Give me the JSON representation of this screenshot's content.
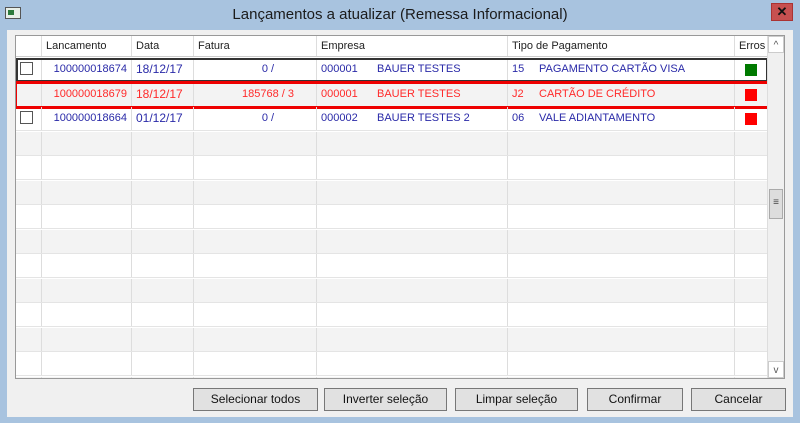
{
  "window": {
    "title": "Lançamentos a atualizar (Remessa Informacional)",
    "close": "✕"
  },
  "grid": {
    "headers": [
      "",
      "Lancamento",
      "Data",
      "Fatura",
      "Empresa",
      "Tipo de Pagamento",
      "Erros"
    ],
    "rows": [
      {
        "lancamento": "100000018674",
        "data": "18/12/17",
        "fatura": "0  /",
        "emp_cod": "000001",
        "emp_nome": "BAUER TESTES",
        "tipo_cod": "15",
        "tipo_nome": "PAGAMENTO CARTÃO VISA",
        "erro_color": "#007a00"
      },
      {
        "lancamento": "100000018679",
        "data": "18/12/17",
        "fatura": "185768  / 3",
        "emp_cod": "000001",
        "emp_nome": "BAUER TESTES",
        "tipo_cod": "J2",
        "tipo_nome": "CARTÃO DE CRÉDITO",
        "erro_color": "#ff0000"
      },
      {
        "lancamento": "100000018664",
        "data": "01/12/17",
        "fatura": "0  /",
        "emp_cod": "000002",
        "emp_nome": "BAUER TESTES 2",
        "tipo_cod": "06",
        "tipo_nome": "VALE ADIANTAMENTO",
        "erro_color": "#ff0000"
      }
    ]
  },
  "scroll": {
    "up": "^",
    "down": "v",
    "thumb": "≡"
  },
  "buttons": {
    "select_all": "Selecionar todos",
    "invert": "Inverter seleção",
    "clear": "Limpar seleção",
    "confirm": "Confirmar",
    "cancel": "Cancelar"
  }
}
